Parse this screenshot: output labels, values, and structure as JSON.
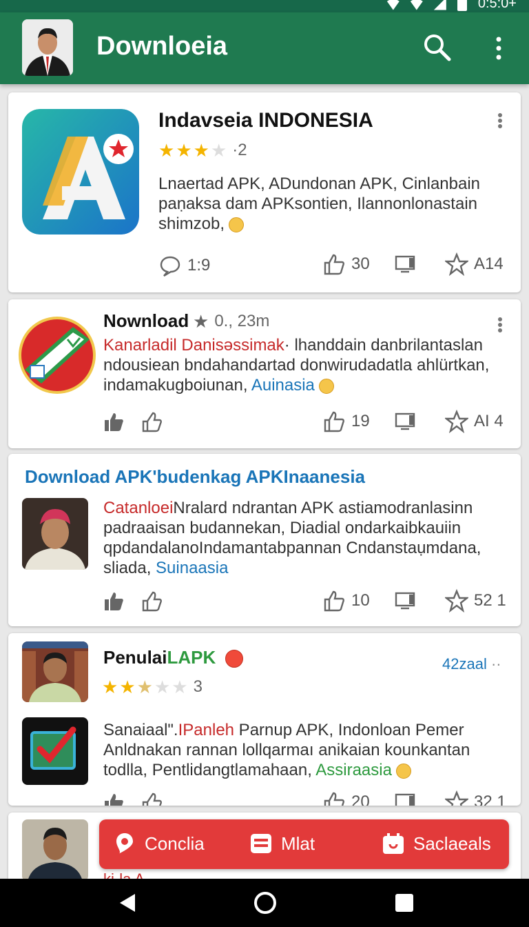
{
  "app": {
    "title": "Downloeia",
    "theme_color": "#1f7a50"
  },
  "status_bar": {
    "time": "0:5:0+"
  },
  "cards": [
    {
      "title": "Indavseia INDONESIA",
      "rating_stars": 3,
      "rating_text": "·2",
      "desc_plain": "Lnaertad APK, ADundonan APK, Cinlanbain paṇaksa  dam APKsontien, Ilannonlonastain shimzob,",
      "comments": "1:9",
      "likes": "30",
      "favorites": "A14"
    },
    {
      "title": "Nownload",
      "rating_text": "0., 23m",
      "desc_red": "Kanarladil Danisəssimak",
      "desc_rest": "· lhanddain danbrilantaslan ndousiean bndahandartad donwirudadatla ahlürtkan, indamakugboiunan,",
      "desc_blue": "Auinasia",
      "likes": "19",
      "favorites": "AI 4"
    },
    {
      "section_header": "Download APK'budenkag APKInaanesia",
      "desc_red": "Catanloei",
      "desc_rest": "Nralard ndrantan APK astiamodranlasinn padraaisan budannekan, Diadial ondarkaibkauiin qpdandalanoIndamantabpannan Cndanstaụmdana, sliada,",
      "desc_blue": "Suinaasia",
      "likes": "10",
      "favorites": "52 1"
    },
    {
      "title_black": "Penulai",
      "title_green": "LAPK",
      "rating_stars": 2.5,
      "rating_text": "3",
      "timestamp": "42zaal",
      "desc_black": "Sanaiaal\".",
      "desc_red": "IPanleh",
      "desc_rest": " Parnup APK, Indonloan Pemer Anldnakan rannan lollqarmaı anikaian kounkantan todlla, Pentlidangtlamahaan,",
      "desc_green": "Assiraasia",
      "likes": "20",
      "favorites": "32 1"
    },
    {
      "partial_text": "ki·la A"
    }
  ],
  "bottom_actions": [
    {
      "label": "Conclia",
      "icon": "location-pin-icon"
    },
    {
      "label": "Mlat",
      "icon": "list-icon"
    },
    {
      "label": "Saclaeals",
      "icon": "calendar-icon"
    }
  ],
  "nav": {
    "back": "back-icon",
    "home": "home-icon",
    "recents": "recents-icon"
  }
}
